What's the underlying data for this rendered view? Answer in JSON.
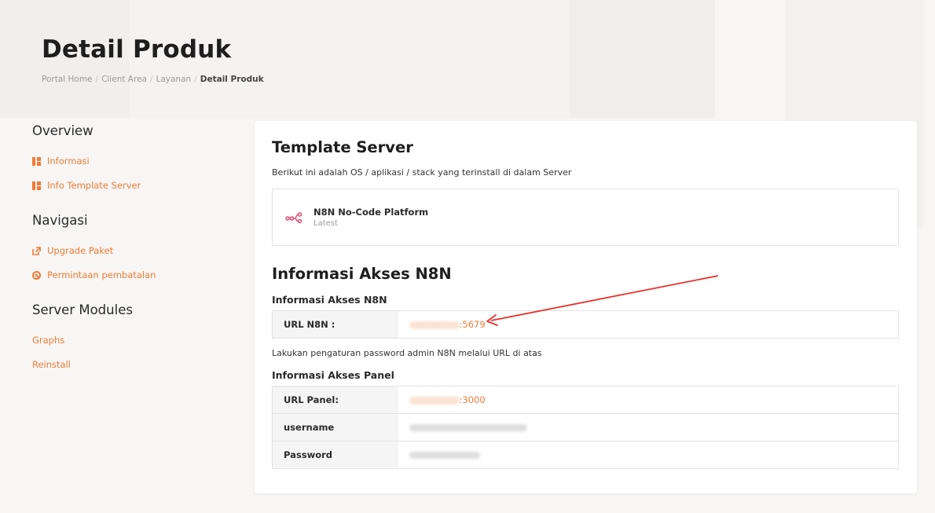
{
  "page": {
    "title": "Detail Produk",
    "breadcrumb": [
      "Portal Home",
      "Client Area",
      "Layanan",
      "Detail Produk"
    ]
  },
  "sidebar": {
    "groups": [
      {
        "heading": "Overview",
        "items": [
          {
            "label": "Informasi",
            "icon": "grid-icon"
          },
          {
            "label": "Info Template Server",
            "icon": "grid-icon"
          }
        ]
      },
      {
        "heading": "Navigasi",
        "items": [
          {
            "label": "Upgrade Paket",
            "icon": "external-link-icon"
          },
          {
            "label": "Permintaan pembatalan",
            "icon": "ban-icon"
          }
        ]
      },
      {
        "heading": "Server Modules",
        "items": [
          {
            "label": "Graphs"
          },
          {
            "label": "Reinstall"
          }
        ]
      }
    ]
  },
  "template_server": {
    "title": "Template Server",
    "description": "Berikut ini adalah OS / aplikasi / stack yang terinstall di dalam Server",
    "app_name": "N8N No-Code Platform",
    "app_version": "Latest",
    "icon": "n8n-logo-icon"
  },
  "access": {
    "title": "Informasi Akses N8N",
    "n8n_heading": "Informasi Akses N8N",
    "n8n_rows": [
      {
        "label": "URL N8N :",
        "port": ":5679"
      }
    ],
    "note": "Lakukan pengaturan password admin N8N melalui URL di atas",
    "panel_heading": "Informasi Akses Panel",
    "panel_rows": [
      {
        "label": "URL Panel:",
        "port": ":3000"
      },
      {
        "label": "username"
      },
      {
        "label": "Password"
      }
    ]
  },
  "colors": {
    "accent": "#f27b35",
    "n8n_logo": "#ea4b71",
    "annotation_arrow": "#e8322d"
  }
}
